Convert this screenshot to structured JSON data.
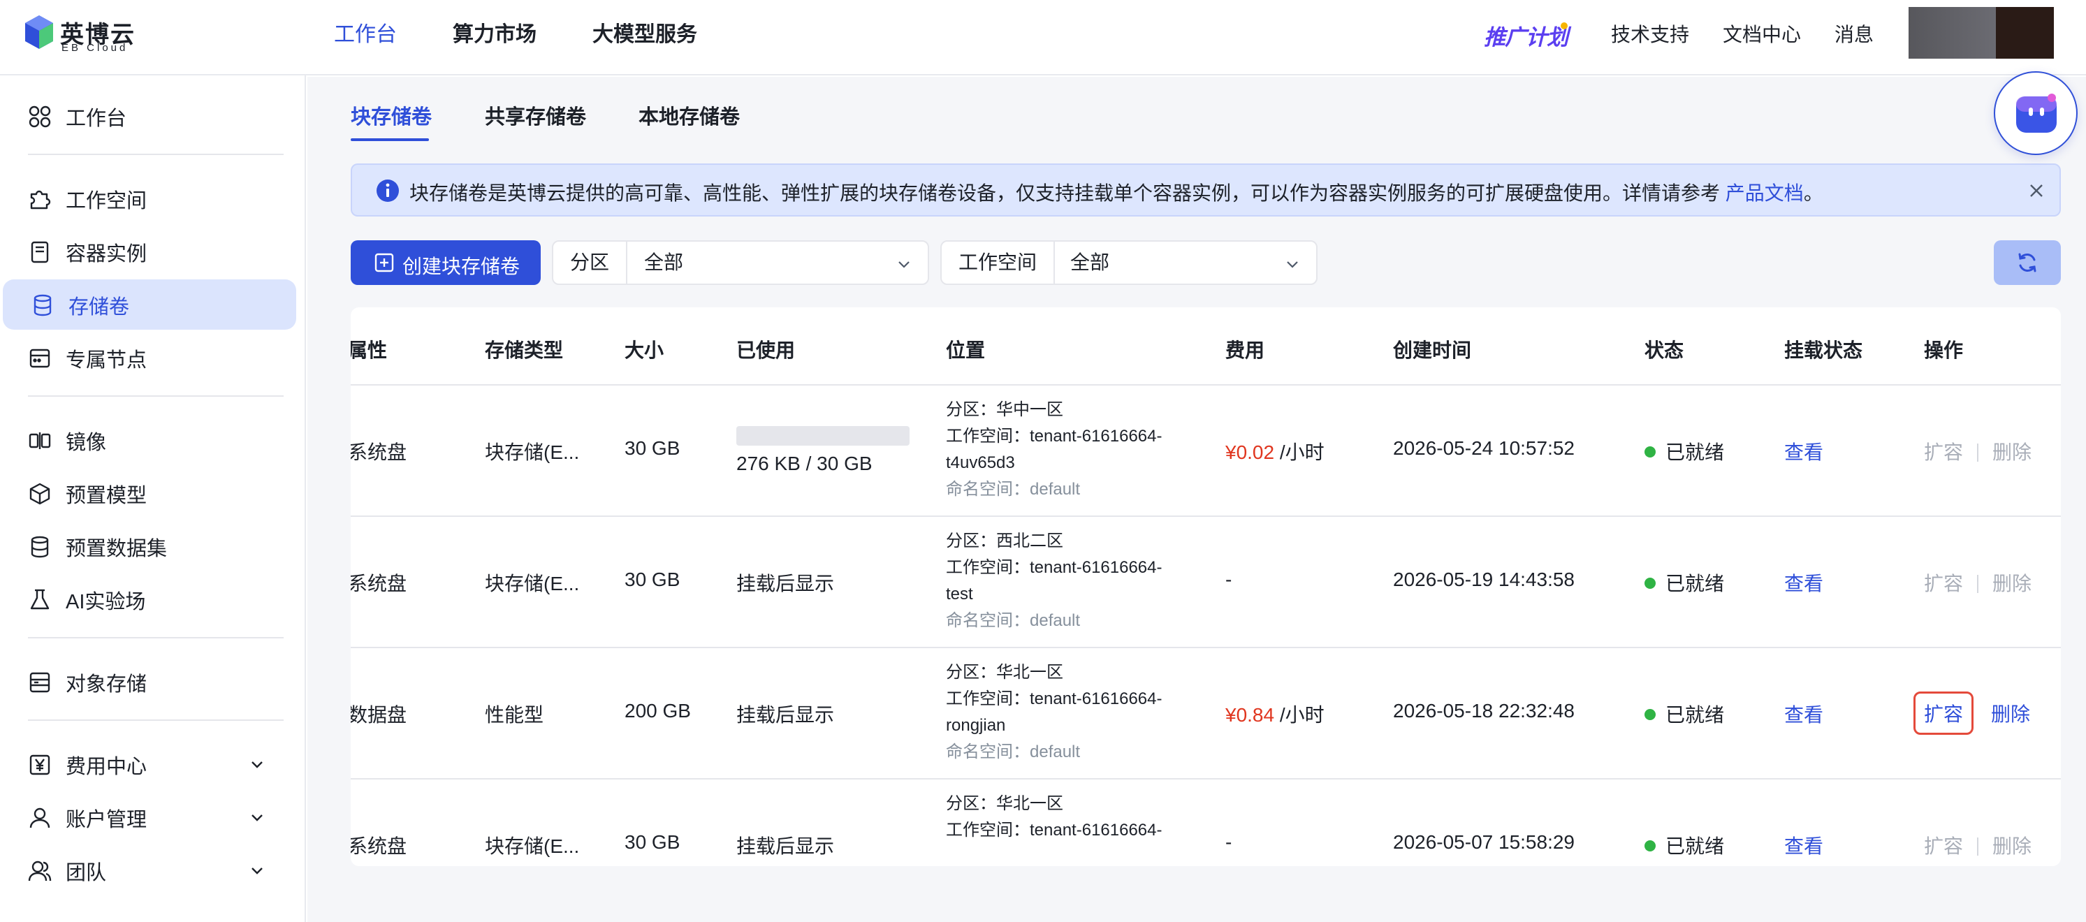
{
  "header": {
    "logo_cn": "英博云",
    "logo_en": "EB Cloud",
    "nav": [
      "工作台",
      "算力市场",
      "大模型服务"
    ],
    "promo": "推广计划",
    "links": [
      "技术支持",
      "文档中心",
      "消息"
    ]
  },
  "sidebar": {
    "items": [
      {
        "label": "工作台",
        "icon": "grid-icon"
      },
      {
        "label": "工作空间",
        "icon": "puzzle-icon"
      },
      {
        "label": "容器实例",
        "icon": "container-icon"
      },
      {
        "label": "存储卷",
        "icon": "database-icon",
        "active": true
      },
      {
        "label": "专属节点",
        "icon": "server-icon"
      },
      {
        "label": "镜像",
        "icon": "mirror-icon"
      },
      {
        "label": "预置模型",
        "icon": "cube-icon"
      },
      {
        "label": "预置数据集",
        "icon": "dataset-icon"
      },
      {
        "label": "AI实验场",
        "icon": "flask-icon"
      },
      {
        "label": "对象存储",
        "icon": "storage-icon"
      },
      {
        "label": "费用中心",
        "icon": "yen-icon"
      },
      {
        "label": "账户管理",
        "icon": "user-icon"
      },
      {
        "label": "团队",
        "icon": "team-icon"
      }
    ]
  },
  "tabs": [
    "块存储卷",
    "共享存储卷",
    "本地存储卷"
  ],
  "notice": {
    "text": "块存储卷是英博云提供的高可靠、高性能、弹性扩展的块存储卷设备，仅支持挂载单个容器实例，可以作为容器实例服务的可扩展硬盘使用。详情请参考 ",
    "link": "产品文档",
    "suffix": "。"
  },
  "toolbar": {
    "create_label": "创建块存储卷",
    "filter_zone_label": "分区",
    "filter_zone_value": "全部",
    "filter_ws_label": "工作空间",
    "filter_ws_value": "全部"
  },
  "table": {
    "columns": [
      "属性",
      "存储类型",
      "大小",
      "已使用",
      "位置",
      "费用",
      "创建时间",
      "状态",
      "挂载状态",
      "操作"
    ],
    "rows": [
      {
        "attr": "系统盘",
        "type": "块存储(E...",
        "size": "30 GB",
        "used": "276 KB / 30 GB",
        "usage_fraction": 0.0,
        "zone": "分区：华中一区",
        "ws1": "工作空间：tenant-61616664-",
        "ws2": "t4uv65d3",
        "ns": "命名空间：default",
        "fee_amount": "¥0.02",
        "fee_unit": " /小时",
        "created": "2026-05-24 10:57:52",
        "status": "已就绪",
        "mount": "查看",
        "op_expand": "扩容",
        "op_delete": "删除",
        "ops_enabled": false
      },
      {
        "attr": "系统盘",
        "type": "块存储(E...",
        "size": "30 GB",
        "used": "挂载后显示",
        "zone": "分区：西北二区",
        "ws1": "工作空间：tenant-61616664-",
        "ws2": "test",
        "ns": "命名空间：default",
        "fee_amount": "-",
        "fee_unit": "",
        "created": "2026-05-19 14:43:58",
        "status": "已就绪",
        "mount": "查看",
        "op_expand": "扩容",
        "op_delete": "删除",
        "ops_enabled": false
      },
      {
        "attr": "数据盘",
        "type": "性能型",
        "size": "200 GB",
        "used": "挂载后显示",
        "zone": "分区：华北一区",
        "ws1": "工作空间：tenant-61616664-",
        "ws2": "rongjian",
        "ns": "命名空间：default",
        "fee_amount": "¥0.84",
        "fee_unit": " /小时",
        "created": "2026-05-18 22:32:48",
        "status": "已就绪",
        "mount": "查看",
        "op_expand": "扩容",
        "op_delete": "删除",
        "ops_enabled": true
      },
      {
        "attr": "系统盘",
        "type": "块存储(E...",
        "size": "30 GB",
        "used": "挂载后显示",
        "zone": "分区：华北一区",
        "ws1": "工作空间：tenant-61616664-",
        "fee_amount": "-",
        "fee_unit": "",
        "created": "2026-05-07 15:58:29",
        "status": "已就绪",
        "mount": "查看",
        "op_expand": "扩容",
        "op_delete": "删除",
        "ops_enabled": false
      }
    ]
  },
  "colors": {
    "accent": "#2f4fd9",
    "accent_light": "#dbe4fd",
    "fee": "#e0361f",
    "status_ok": "#2fb344",
    "highlight": "#e44a3b"
  }
}
